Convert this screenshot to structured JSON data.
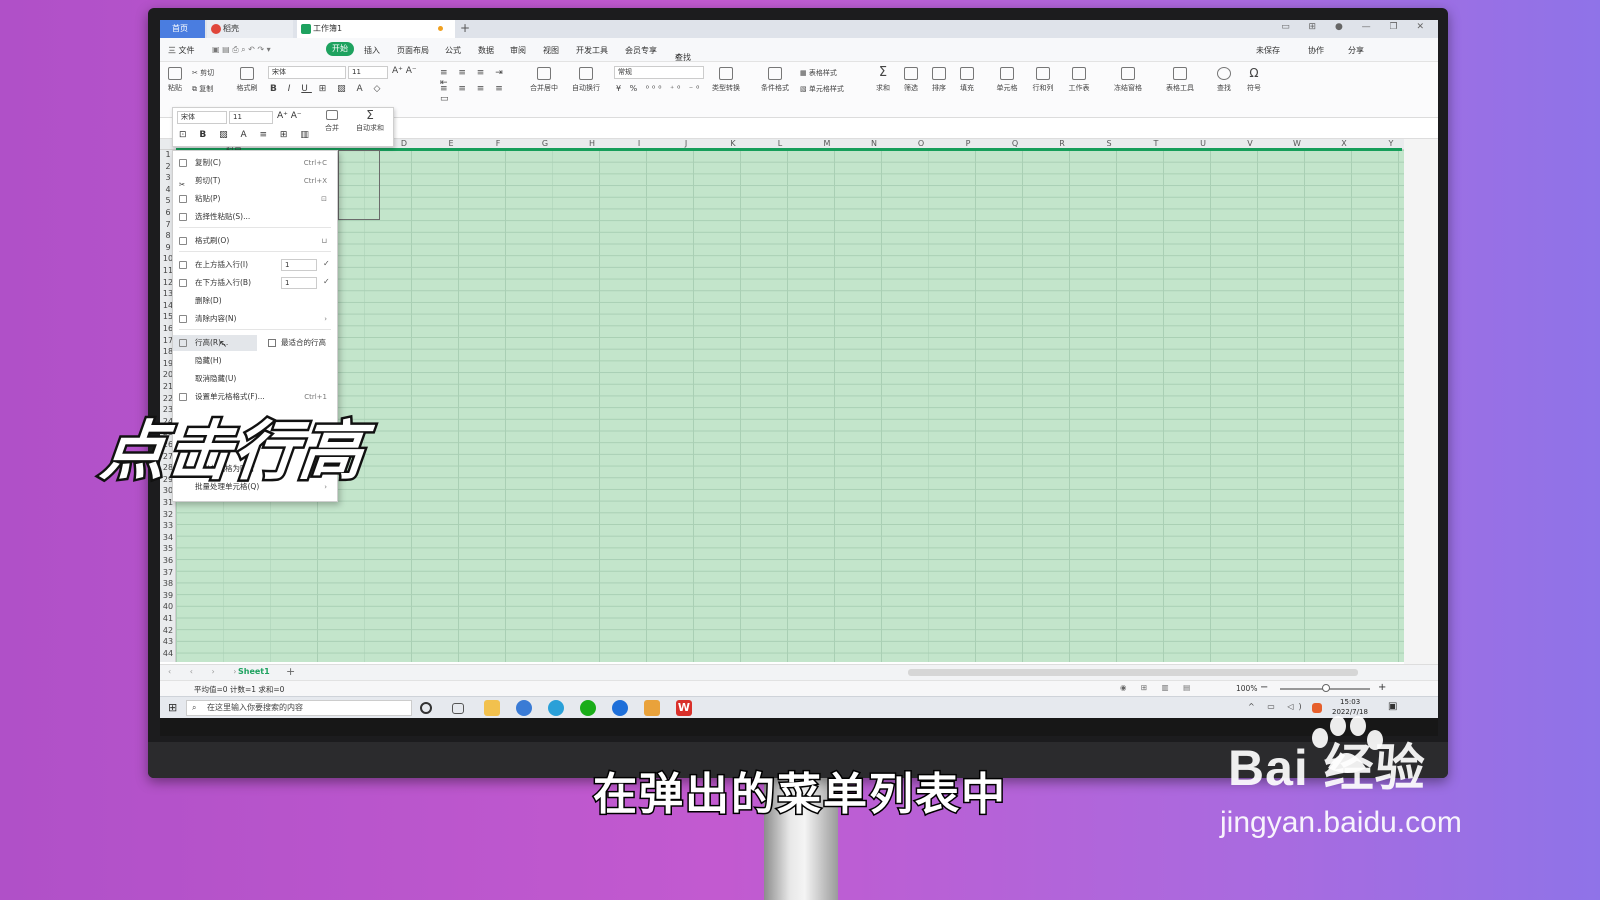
{
  "titlebar": {
    "tabs": [
      {
        "label": "首页"
      },
      {
        "label": "稻壳"
      },
      {
        "label": "工作簿1"
      }
    ],
    "new_tab": "+"
  },
  "menubar": {
    "file": "三 文件",
    "items": [
      "开始",
      "插入",
      "页面布局",
      "公式",
      "数据",
      "审阅",
      "视图",
      "开发工具",
      "会员专享"
    ],
    "search_placeholder": "查找命令、搜索模板",
    "right": [
      "未保存",
      "协作",
      "分享"
    ]
  },
  "ribbon": {
    "paste": "粘贴",
    "cut": "剪切",
    "copy": "复制",
    "format_painter": "格式刷",
    "font_name": "宋体",
    "font_size": "11",
    "merge_center": "合并居中",
    "wrap": "自动换行",
    "number_format": "常规",
    "type_convert": "类型转换",
    "cond_format": "条件格式",
    "table_style": "表格样式",
    "cell_style": "单元格样式",
    "sum": "求和",
    "filter": "筛选",
    "sort": "排序",
    "fill": "填充",
    "cell": "单元格",
    "row_col": "行和列",
    "worksheet": "工作表",
    "freeze": "冻结窗格",
    "table_tools": "表格工具",
    "find": "查找",
    "symbol": "符号"
  },
  "mini_toolbar": {
    "font_name": "宋体",
    "font_size": "11",
    "merge": "合并",
    "autosum": "自动求和"
  },
  "columns": [
    "D",
    "E",
    "F",
    "G",
    "H",
    "I",
    "J",
    "K",
    "L",
    "M",
    "N",
    "O",
    "P",
    "Q",
    "R",
    "S",
    "T",
    "U",
    "V",
    "W",
    "X",
    "Y"
  ],
  "cell_b1_partial": "科目",
  "context_menu": {
    "items": [
      {
        "label": "复制(C)",
        "shortcut": "Ctrl+C"
      },
      {
        "label": "剪切(T)",
        "shortcut": "Ctrl+X"
      },
      {
        "label": "粘贴(P)",
        "shortcut": ""
      },
      {
        "label": "选择性粘贴(S)...",
        "shortcut": ""
      },
      {
        "label": "格式刷(O)",
        "shortcut": ""
      },
      {
        "label": "在上方插入行(I)",
        "shortcut": ""
      },
      {
        "label": "在下方插入行(B)",
        "shortcut": ""
      },
      {
        "label": "删除(D)",
        "shortcut": ""
      },
      {
        "label": "清除内容(N)",
        "shortcut": ""
      },
      {
        "label": "行高(R)...",
        "shortcut": ""
      },
      {
        "label": "隐藏(H)",
        "shortcut": ""
      },
      {
        "label": "取消隐藏(U)",
        "shortcut": ""
      },
      {
        "label": "设置单元格格式(F)...",
        "shortcut": "Ctrl+1"
      },
      {
        "label": "输出单元格为图片",
        "shortcut": ""
      },
      {
        "label": "批量处理单元格(Q)",
        "shortcut": ""
      }
    ],
    "insert_above_count": "1",
    "insert_below_count": "1",
    "best_fit_row_height": "最适合的行高"
  },
  "sheet": {
    "tab": "Sheet1",
    "status": "平均值=0  计数=1  求和=0",
    "zoom": "100%"
  },
  "taskbar": {
    "search_placeholder": "在这里输入你要搜索的内容",
    "time": "15:03",
    "date": "2022/7/18"
  },
  "overlay": {
    "big_caption": "点击行高",
    "subtitle": "在弹出的菜单列表中",
    "watermark_brand": "Bai  经验",
    "watermark_url": "jingyan.baidu.com"
  }
}
